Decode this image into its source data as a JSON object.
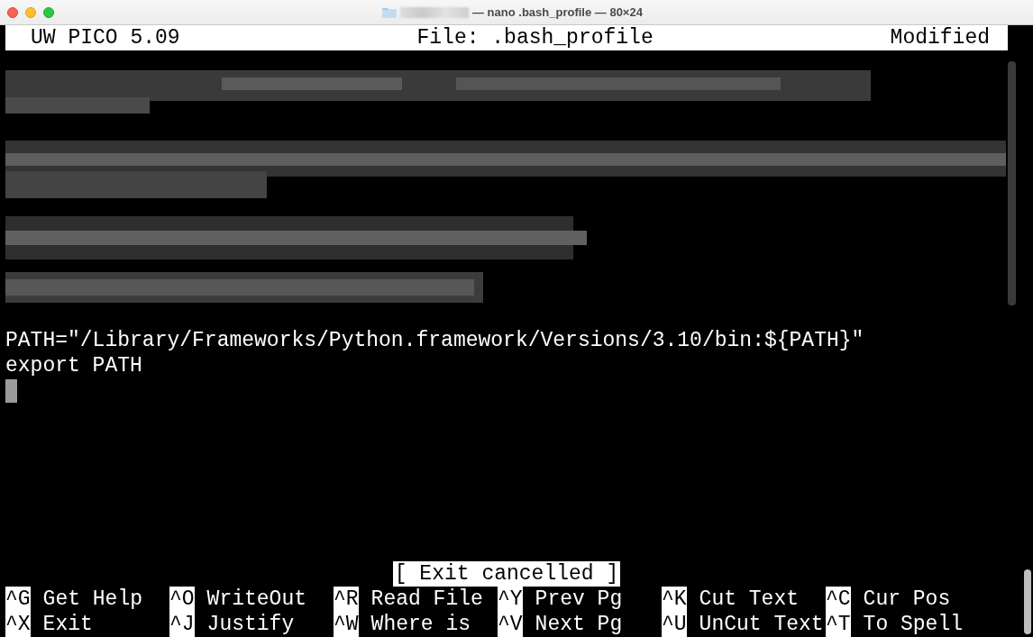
{
  "window": {
    "title": "— nano .bash_profile — 80×24"
  },
  "header": {
    "app": "UW PICO 5.09",
    "file": "File: .bash_profile",
    "status": "Modified"
  },
  "lines": [
    "PATH=\"/Library/Frameworks/Python.framework/Versions/3.10/bin:${PATH}\"",
    "export PATH"
  ],
  "status_message": "[ Exit cancelled ]",
  "shortcuts": [
    [
      {
        "key": "^G",
        "label": "Get Help"
      },
      {
        "key": "^O",
        "label": "WriteOut"
      },
      {
        "key": "^R",
        "label": "Read File"
      },
      {
        "key": "^Y",
        "label": "Prev Pg"
      },
      {
        "key": "^K",
        "label": "Cut Text"
      },
      {
        "key": "^C",
        "label": "Cur Pos"
      }
    ],
    [
      {
        "key": "^X",
        "label": "Exit"
      },
      {
        "key": "^J",
        "label": "Justify"
      },
      {
        "key": "^W",
        "label": "Where is"
      },
      {
        "key": "^V",
        "label": "Next Pg"
      },
      {
        "key": "^U",
        "label": "UnCut Text"
      },
      {
        "key": "^T",
        "label": "To Spell"
      }
    ]
  ]
}
